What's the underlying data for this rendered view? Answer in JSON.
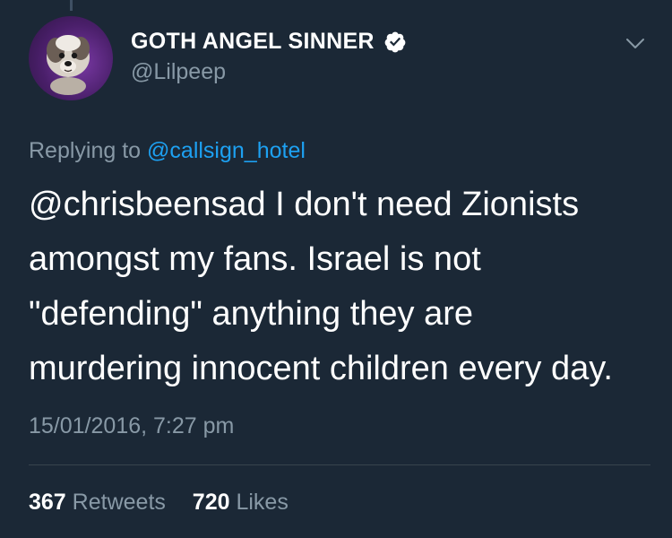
{
  "colors": {
    "background": "#1b2836",
    "primary_text": "#ffffff",
    "secondary_text": "#8899a6",
    "link": "#1da1f2",
    "divider": "#38444d"
  },
  "author": {
    "display_name": "GOTH ANGEL SINNER",
    "handle": "@Lilpeep",
    "verified": true,
    "avatar_icon": "dog-avatar"
  },
  "reply": {
    "prefix": "Replying to",
    "mention": "@callsign_hotel"
  },
  "tweet": {
    "text": "@chrisbeensad I don't need Zionists\namongst my fans. Israel is not\n\"defending\" anything they are\nmurdering innocent children every day.",
    "timestamp": "15/01/2016, 7:27 pm"
  },
  "stats": {
    "retweets_count": "367",
    "retweets_label": "Retweets",
    "likes_count": "720",
    "likes_label": "Likes"
  },
  "icons": {
    "verified": "verified-badge-icon",
    "menu": "chevron-down-icon"
  }
}
